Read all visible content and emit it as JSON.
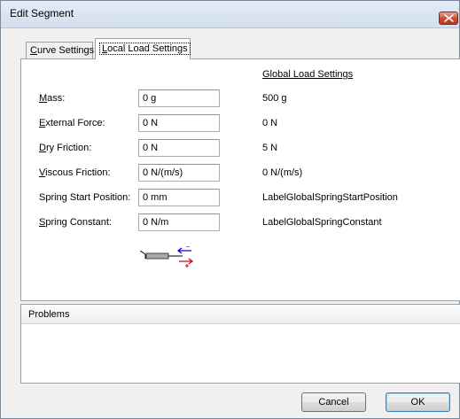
{
  "window": {
    "title": "Edit Segment",
    "close_icon": "close-icon"
  },
  "tabs": [
    {
      "label_prefix": "C",
      "label_rest": "urve Settings",
      "selected": false
    },
    {
      "label_prefix": "L",
      "label_rest": "ocal Load Settings",
      "selected": true
    }
  ],
  "local": {
    "global_header": "Global Load Settings",
    "rows": [
      {
        "label_prefix": "M",
        "label_rest": "ass:",
        "value": "0 g",
        "global": "500 g"
      },
      {
        "label_prefix": "E",
        "label_rest": "xternal Force:",
        "value": "0 N",
        "global": "0 N"
      },
      {
        "label_prefix": "D",
        "label_rest": "ry Friction:",
        "value": "0 N",
        "global": "5 N"
      },
      {
        "label_prefix": "V",
        "label_rest": "iscous Friction:",
        "value": "0 N/(m/s)",
        "global": "0 N/(m/s)"
      },
      {
        "label_prefix": "",
        "label_rest": "Spring Start Position:",
        "value": "0 mm",
        "global": "LabelGlobalSpringStartPosition"
      },
      {
        "label_prefix": "S",
        "label_rest": "pring Constant:",
        "value": "0 N/m",
        "global": "LabelGlobalSpringConstant"
      }
    ],
    "diagram_icon": "spring-direction-icon",
    "diagram_colors": {
      "minus": "#0000c8",
      "plus": "#d00000"
    }
  },
  "problems": {
    "title": "Problems"
  },
  "buttons": {
    "cancel": "Cancel",
    "ok": "OK"
  }
}
